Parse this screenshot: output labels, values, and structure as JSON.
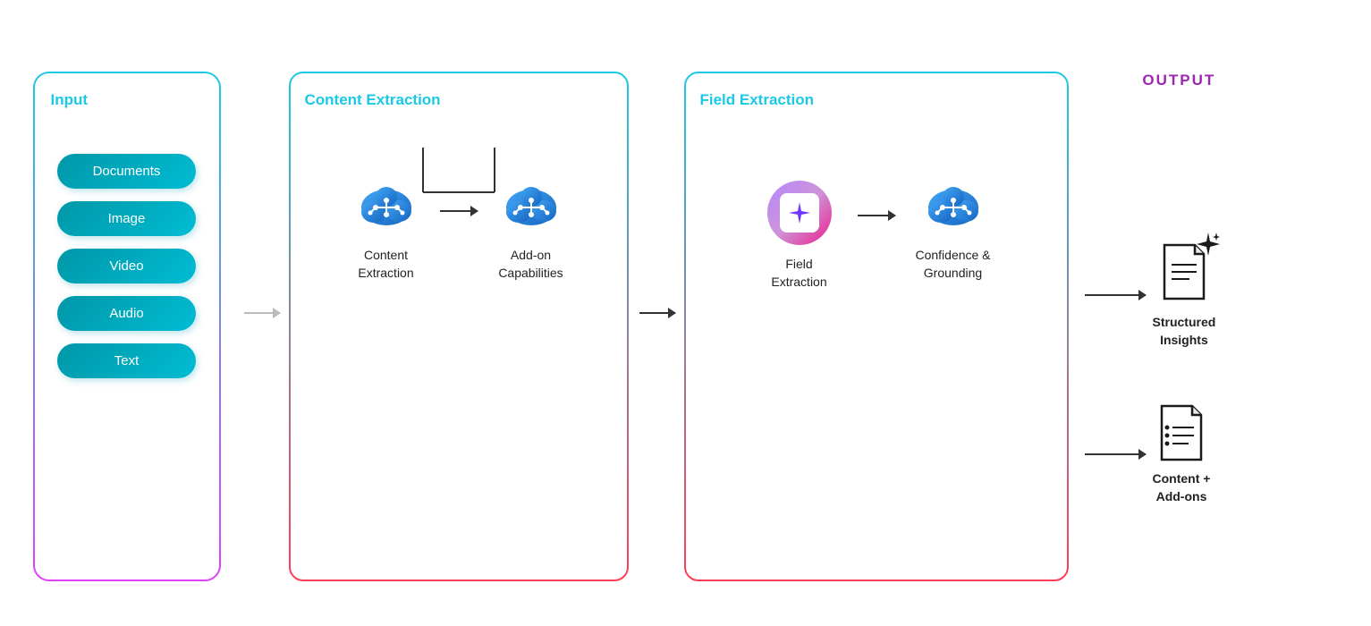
{
  "input": {
    "label": "Input",
    "items": [
      "Documents",
      "Image",
      "Video",
      "Audio",
      "Text"
    ]
  },
  "content_extraction": {
    "label": "Content Extraction",
    "nodes": [
      {
        "id": "content-extraction-node",
        "label": "Content\nExtraction"
      },
      {
        "id": "addon-capabilities-node",
        "label": "Add-on\nCapabilities"
      }
    ]
  },
  "field_extraction": {
    "label": "Field Extraction",
    "nodes": [
      {
        "id": "field-extraction-node",
        "label": "Field\nExtraction"
      },
      {
        "id": "confidence-grounding-node",
        "label": "Confidence &\nGrounding"
      }
    ]
  },
  "output": {
    "label": "OUTPUT",
    "items": [
      {
        "id": "structured-insights",
        "label": "Structured\nInsights"
      },
      {
        "id": "content-addons",
        "label": "Content +\nAdd-ons"
      }
    ]
  }
}
